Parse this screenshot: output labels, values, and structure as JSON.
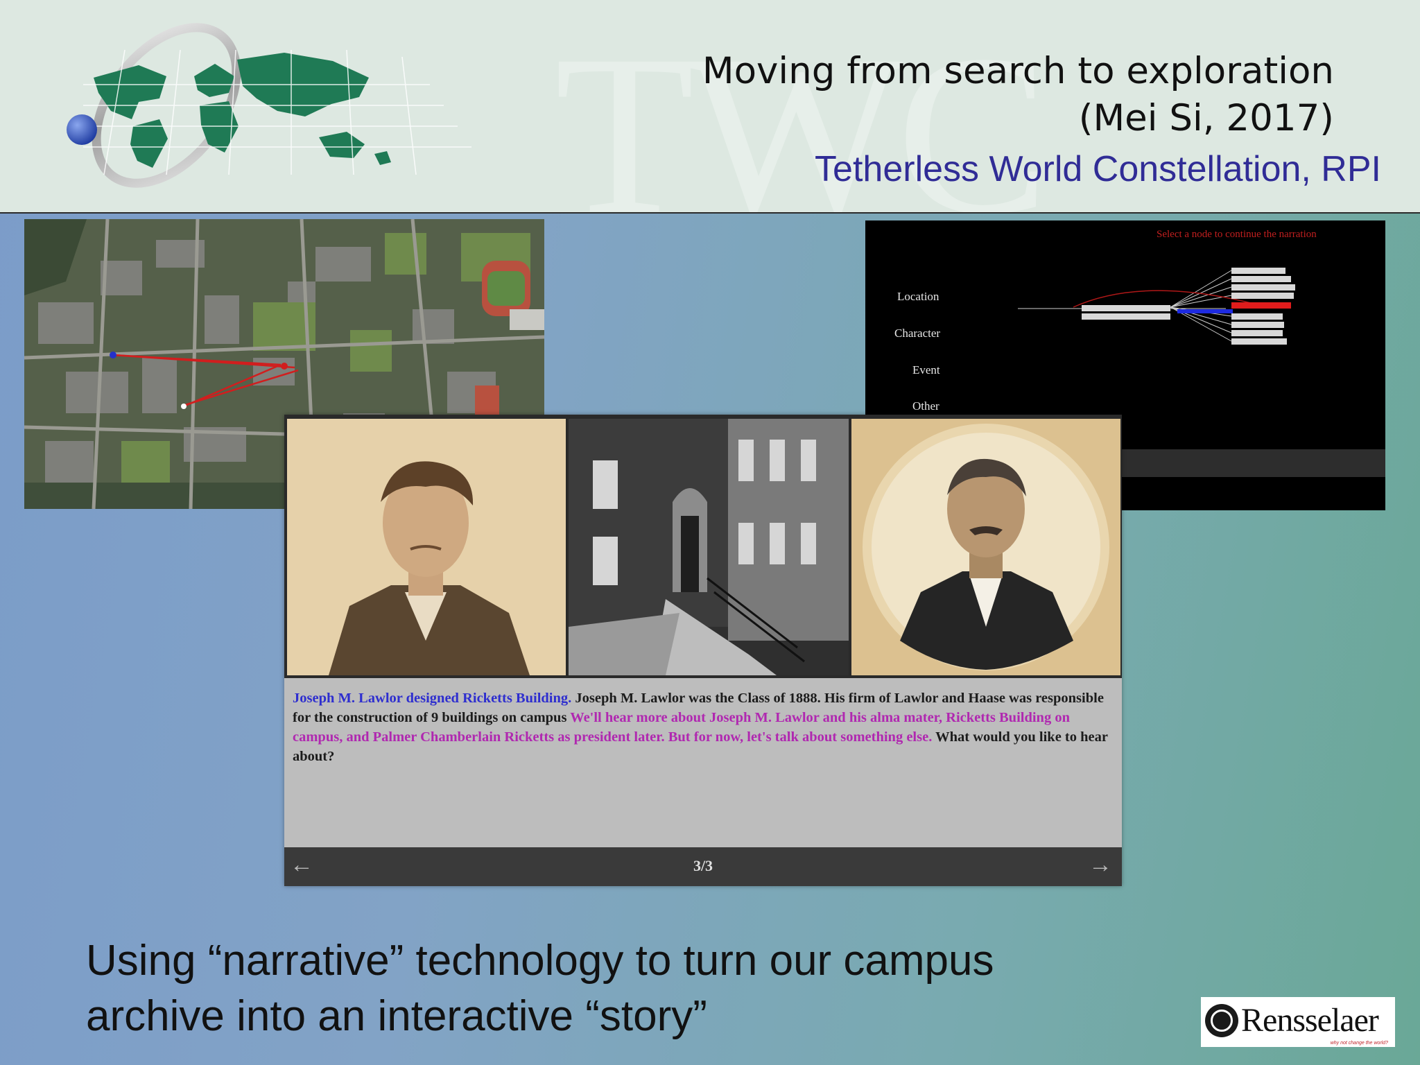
{
  "header": {
    "title_line1": "Moving from search to exploration",
    "title_line2": "(Mei Si, 2017)",
    "organization": "Tetherless World Constellation, RPI",
    "watermark": "TWC"
  },
  "graph_panel": {
    "instruction": "Select a node to continue the narration",
    "categories": [
      "Location",
      "Character",
      "Event",
      "Other"
    ]
  },
  "story_viewer": {
    "caption_blue": "Joseph M. Lawlor designed Ricketts Building.",
    "caption_black": " Joseph M. Lawlor was the Class of 1888. His firm of Lawlor and Haase was responsible for the construction of 9 buildings on campus  ",
    "caption_magenta": "We'll hear more about Joseph M. Lawlor and his alma mater, Ricketts Building on campus, and Palmer Chamberlain Ricketts as president later. But for now, let's talk about something else.",
    "caption_question": " What would you like to hear about?",
    "pager": "3/3",
    "prev_icon": "arrow-left-icon",
    "next_icon": "arrow-right-icon"
  },
  "footer": {
    "line1": "Using “narrative” technology to turn our campus",
    "line2": "archive into an interactive  “story”"
  },
  "logo": {
    "name": "Rensselaer",
    "tagline": "why not change the world?"
  },
  "colors": {
    "org_text": "#302c96",
    "caption_blue": "#2e2ecf",
    "caption_magenta": "#b028b0"
  }
}
